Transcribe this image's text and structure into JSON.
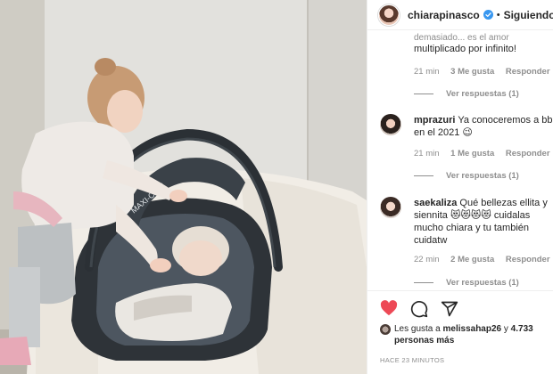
{
  "post": {
    "username": "chiarapinasco",
    "follow_status": "Siguiendo",
    "separator": "•"
  },
  "comments": [
    {
      "text": "multiplicado por infinito!",
      "partial_text": "demasiado... es el amor",
      "time": "21 min",
      "likes": "3 Me gusta",
      "reply": "Responder",
      "view_replies": "Ver respuestas (1)"
    },
    {
      "username": "mprazuri",
      "text": "Ya conoceremos a bb en el 2021 😉",
      "time": "21 min",
      "likes": "1 Me gusta",
      "reply": "Responder",
      "view_replies": "Ver respuestas (1)"
    },
    {
      "username": "saekaliza",
      "text": "Qué bellezas ellita y siennita 😻😻😻😻 cuidalas mucho chiara y tu también cuidatw",
      "time": "22 min",
      "likes": "2 Me gusta",
      "reply": "Responder",
      "view_replies": "Ver respuestas (1)"
    }
  ],
  "engagement": {
    "liked_prefix": "Les gusta a",
    "liked_user": "melissahap26",
    "liked_mid": "y",
    "liked_count": "4.733 personas más",
    "time_ago": "HACE 23 MINUTOS"
  },
  "colors": {
    "like_red": "#ed4956",
    "verified_blue": "#3897f0",
    "muted": "#8e8e8e",
    "text": "#262626"
  },
  "icons": [
    "verified-icon",
    "heart-icon",
    "comment-icon",
    "share-icon"
  ]
}
